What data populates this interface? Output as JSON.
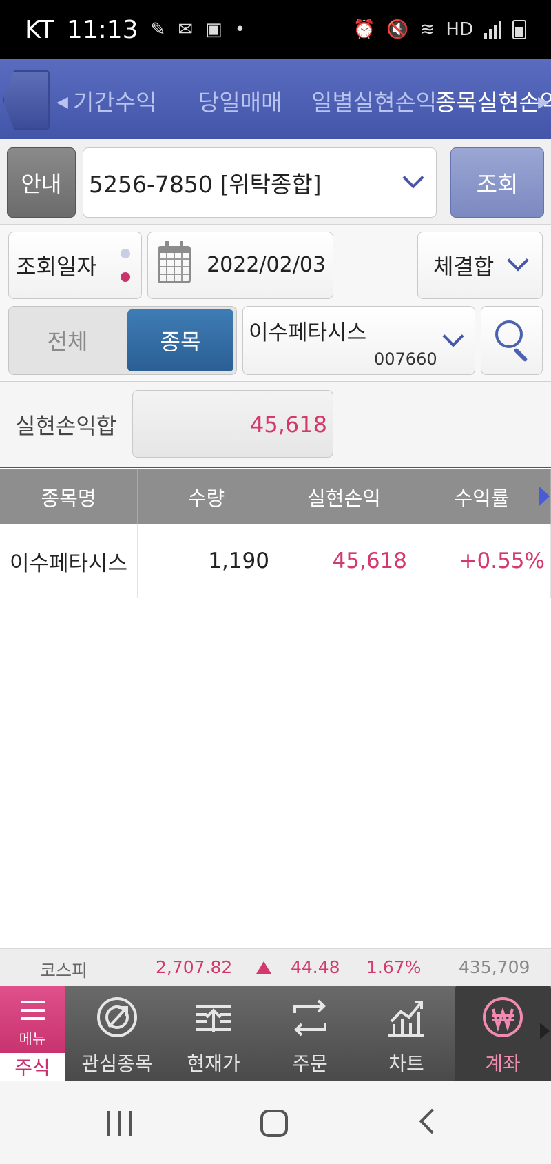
{
  "status_bar": {
    "carrier": "KT",
    "time": "11:13",
    "hd_label": "HD"
  },
  "tabs": {
    "items": [
      "기간수익",
      "당일매매",
      "일별실현손익",
      "종목실현손익"
    ],
    "active_index": 3
  },
  "account": {
    "guide_label": "안내",
    "account_value": "5256-7850 [위탁종합]",
    "query_label": "조회"
  },
  "filters": {
    "date_label": "조회일자",
    "date_value": "2022/02/03",
    "exec_option": "체결합",
    "segment_all": "전체",
    "segment_item": "종목",
    "segment_selected": "종목",
    "stock_name": "이수페타시스",
    "stock_code": "007660"
  },
  "summary": {
    "label": "실현손익합",
    "value": "45,618"
  },
  "table": {
    "headers": [
      "종목명",
      "수량",
      "실현손익",
      "수익률"
    ],
    "rows": [
      {
        "name": "이수페타시스",
        "qty": "1,190",
        "pnl": "45,618",
        "rate": "+0.55%"
      }
    ]
  },
  "ticker": {
    "index_name": "코스피",
    "price": "2,707.82",
    "change": "44.48",
    "rate": "1.67%",
    "volume": "435,709"
  },
  "bottom_nav": {
    "menu_label": "메뉴",
    "menu_section": "주식",
    "items": [
      "관심종목",
      "현재가",
      "주문",
      "차트",
      "계좌"
    ],
    "active_index": 4
  },
  "colors": {
    "accent": "#4255a8",
    "positive": "#d33a6b",
    "segment_active": "#2f6a9f",
    "menu_pink": "#d8407c"
  },
  "icons": [
    "calendar-icon",
    "search-icon",
    "chevron-down-icon",
    "hamburger-icon",
    "watchlist-icon",
    "current-price-icon",
    "order-icon",
    "chart-icon",
    "won-account-icon"
  ]
}
